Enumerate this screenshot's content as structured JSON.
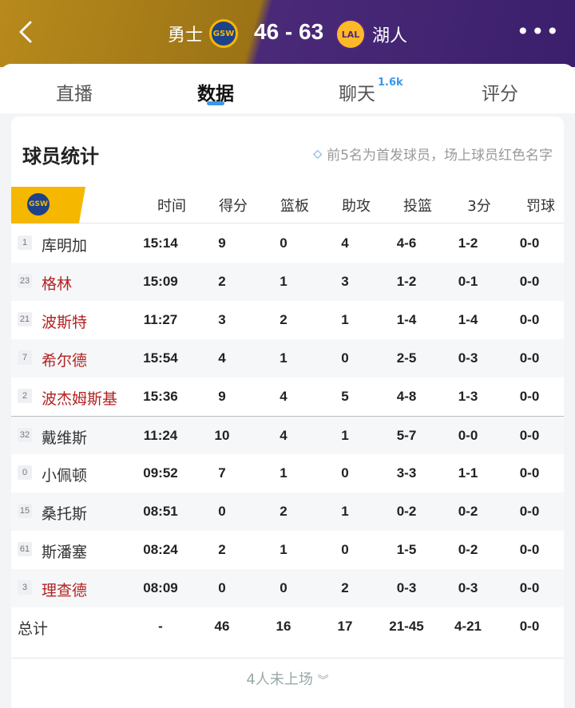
{
  "header": {
    "home_team": "勇士",
    "home_logo": "GSW",
    "score": "46 - 63",
    "away_logo": "LAL",
    "away_team": "湖人"
  },
  "tabs": [
    {
      "label": "直播"
    },
    {
      "label": "数据"
    },
    {
      "label": "聊天",
      "badge": "1.6k"
    },
    {
      "label": "评分"
    }
  ],
  "section": {
    "title": "球员统计",
    "note": "前5名为首发球员，场上球员红色名字"
  },
  "table": {
    "team_logo": "GSW",
    "columns": [
      "时间",
      "得分",
      "篮板",
      "助攻",
      "投篮",
      "3分",
      "罚球"
    ],
    "rows": [
      {
        "num": "1",
        "name": "库明加",
        "on_court": false,
        "stats": [
          "15:14",
          "9",
          "0",
          "4",
          "4-6",
          "1-2",
          "0-0"
        ]
      },
      {
        "num": "23",
        "name": "格林",
        "on_court": true,
        "stats": [
          "15:09",
          "2",
          "1",
          "3",
          "1-2",
          "0-1",
          "0-0"
        ]
      },
      {
        "num": "21",
        "name": "波斯特",
        "on_court": true,
        "stats": [
          "11:27",
          "3",
          "2",
          "1",
          "1-4",
          "1-4",
          "0-0"
        ]
      },
      {
        "num": "7",
        "name": "希尔德",
        "on_court": true,
        "stats": [
          "15:54",
          "4",
          "1",
          "0",
          "2-5",
          "0-3",
          "0-0"
        ]
      },
      {
        "num": "2",
        "name": "波杰姆斯基",
        "on_court": true,
        "stats": [
          "15:36",
          "9",
          "4",
          "5",
          "4-8",
          "1-3",
          "0-0"
        ]
      },
      {
        "num": "32",
        "name": "戴维斯",
        "on_court": false,
        "stats": [
          "11:24",
          "10",
          "4",
          "1",
          "5-7",
          "0-0",
          "0-0"
        ]
      },
      {
        "num": "0",
        "name": "小佩顿",
        "on_court": false,
        "stats": [
          "09:52",
          "7",
          "1",
          "0",
          "3-3",
          "1-1",
          "0-0"
        ]
      },
      {
        "num": "15",
        "name": "桑托斯",
        "on_court": false,
        "stats": [
          "08:51",
          "0",
          "2",
          "1",
          "0-2",
          "0-2",
          "0-0"
        ]
      },
      {
        "num": "61",
        "name": "斯潘塞",
        "on_court": false,
        "stats": [
          "08:24",
          "2",
          "1",
          "0",
          "1-5",
          "0-2",
          "0-0"
        ]
      },
      {
        "num": "3",
        "name": "理查德",
        "on_court": true,
        "stats": [
          "08:09",
          "0",
          "0",
          "2",
          "0-3",
          "0-3",
          "0-0"
        ]
      }
    ],
    "total": {
      "label": "总计",
      "stats": [
        "-",
        "46",
        "16",
        "17",
        "21-45",
        "4-21",
        "0-0"
      ]
    }
  },
  "footer": {
    "more_label": "4人未上场"
  },
  "colors": {
    "accent": "#3a98e8",
    "on_court_name": "#b22222",
    "gsw_gold": "#f5b700",
    "lal_purple": "#552583"
  }
}
